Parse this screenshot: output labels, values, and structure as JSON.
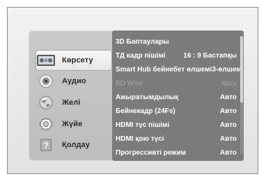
{
  "menu": {
    "items": [
      {
        "label": "Көрсету",
        "icon": "display-settings-icon",
        "selected": true
      },
      {
        "label": "Аудио",
        "icon": "speaker-icon",
        "selected": false
      },
      {
        "label": "Желі",
        "icon": "globe-network-icon",
        "selected": false
      },
      {
        "label": "Жүйе",
        "icon": "gear-icon",
        "selected": false
      },
      {
        "label": "Қолдау",
        "icon": "help-question-icon",
        "selected": false
      }
    ]
  },
  "panel": {
    "rows": [
      {
        "label": "3D Баптаулары",
        "value": ""
      },
      {
        "label": "ТД кадр пішімі",
        "value": "16 : 9 Бастапқы"
      },
      {
        "label": "Smart Hub бейнебет өлшемі",
        "value": "3-өлшем"
      },
      {
        "label": "BD Wise",
        "value": "Қосу",
        "disabled": true
      },
      {
        "label": "Ажыратымдылық",
        "value": "Авто"
      },
      {
        "label": "Бейнекадр (24Fs)",
        "value": "Авто"
      },
      {
        "label": "HDMI түс пішімі",
        "value": "Авто"
      },
      {
        "label": "HDMI қою түсі",
        "value": "Авто"
      },
      {
        "label": "Прогрессивті режим",
        "value": "Авто"
      }
    ]
  },
  "colors": {
    "panel": "#7b7b7b",
    "menu": "#c4c4c4",
    "highlight": "#f2f2f2"
  }
}
